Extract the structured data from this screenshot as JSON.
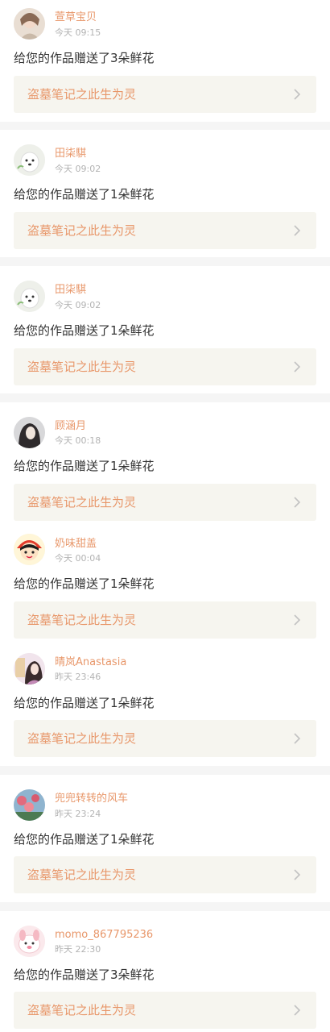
{
  "notifications": [
    {
      "username": "萱草宝贝",
      "time": "今天 09:15",
      "message": "给您的作品赠送了3朵鲜花",
      "work_title": "盗墓笔记之此生为灵",
      "avatar_icon": "portrait-girl-avatar"
    },
    {
      "username": "田柒騏",
      "time": "今天 09:02",
      "message": "给您的作品赠送了1朵鲜花",
      "work_title": "盗墓笔记之此生为灵",
      "avatar_icon": "white-dog-avatar"
    },
    {
      "username": "田柒騏",
      "time": "今天 09:02",
      "message": "给您的作品赠送了1朵鲜花",
      "work_title": "盗墓笔记之此生为灵",
      "avatar_icon": "white-dog-avatar"
    },
    {
      "username": "顾涵月",
      "time": "今天 00:18",
      "message": "给您的作品赠送了1朵鲜花",
      "work_title": "盗墓笔记之此生为灵",
      "avatar_icon": "dark-portrait-avatar"
    },
    {
      "username": "奶味甜盖",
      "time": "今天 00:04",
      "message": "给您的作品赠送了1朵鲜花",
      "work_title": "盗墓笔记之此生为灵",
      "avatar_icon": "cartoon-character-avatar"
    },
    {
      "username": "晴岚Anastasia",
      "time": "昨天 23:46",
      "message": "给您的作品赠送了1朵鲜花",
      "work_title": "盗墓笔记之此生为灵",
      "avatar_icon": "pink-portrait-avatar"
    },
    {
      "username": "兜兜转转的风车",
      "time": "昨天 23:24",
      "message": "给您的作品赠送了1朵鲜花",
      "work_title": "盗墓笔记之此生为灵",
      "avatar_icon": "flower-scene-avatar"
    },
    {
      "username": "momo_867795236",
      "time": "昨天 22:30",
      "message": "给您的作品赠送了3朵鲜花",
      "work_title": "盗墓笔记之此生为灵",
      "avatar_icon": "pink-bunny-avatar"
    }
  ],
  "colors": {
    "accent": "#e8976a",
    "link_bg": "#f6f5ef",
    "page_bg": "#f5f5f5"
  }
}
